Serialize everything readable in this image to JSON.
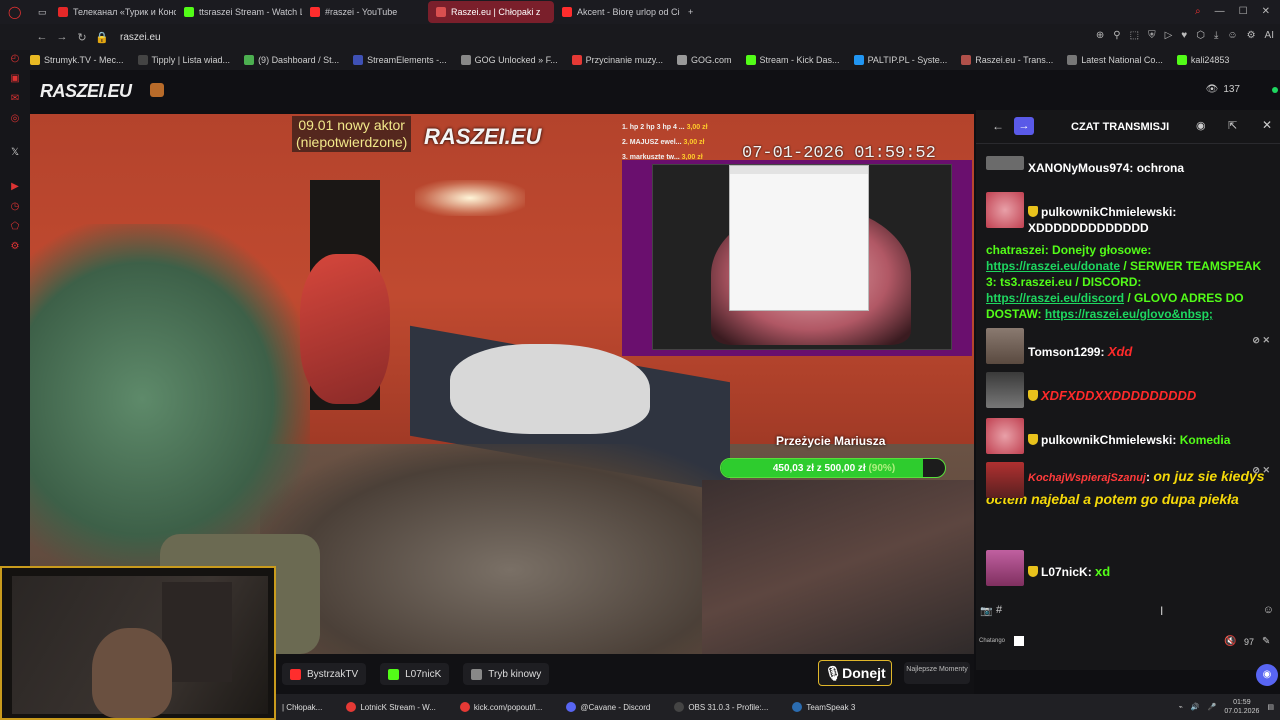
{
  "browser": {
    "tabs": [
      {
        "label": "Телеканал «Турик и Конс",
        "color": "#e52828"
      },
      {
        "label": "ttsraszei Stream - Watch L",
        "color": "#53fc18"
      },
      {
        "label": "#raszei - YouTube",
        "color": "#ff2d2d"
      },
      {
        "label": "Raszei.eu | Chłopaki z",
        "color": "#d94f4f",
        "active": true
      },
      {
        "label": "Akcent - Biorę urlop od Cie",
        "color": "#ff2d2d"
      }
    ],
    "new_tab": "+",
    "url": "raszei.eu",
    "bookmarks": [
      {
        "label": "Strumyk.TV - Mec...",
        "color": "#e8b923"
      },
      {
        "label": "Tipply | Lista wiad...",
        "color": "#222"
      },
      {
        "label": "(9) Dashboard / St...",
        "color": "#4caf50"
      },
      {
        "label": "StreamElements -...",
        "color": "#3f51b5"
      },
      {
        "label": "GOG Unlocked » F...",
        "color": "#888"
      },
      {
        "label": "Przycinanie muzy...",
        "color": "#e53935"
      },
      {
        "label": "GOG.com",
        "color": "#999"
      },
      {
        "label": "Stream - Kick Das...",
        "color": "#53fc18"
      },
      {
        "label": "PALTIP.PL - Syste...",
        "color": "#2196f3"
      },
      {
        "label": "Raszei.eu - Trans...",
        "color": "#b0504a"
      },
      {
        "label": "Latest National Co...",
        "color": "#777"
      },
      {
        "label": "kali24853",
        "color": "#53fc18"
      }
    ]
  },
  "site": {
    "logo": "RASZEI.EU",
    "viewers": "137"
  },
  "video": {
    "overlay_actor_line1": "09.01 nowy aktor",
    "overlay_actor_line2": "(niepotwierdzone)",
    "overlay_logo": "RASZEI.EU",
    "donors": [
      {
        "label": "1. hp 2 hp 3 hp 4 ...",
        "amount": "3,00 zł"
      },
      {
        "label": "2. MAJUSZ ewel...",
        "amount": "3,00 zł"
      },
      {
        "label": "3. markuszte tw...",
        "amount": "3,00 zł"
      }
    ],
    "clock": "07-01-2026 01:59:52",
    "przezycie": "Przeżycie Mariusza",
    "goal_text": "450,03 zł z 500,00 zł",
    "goal_pct_label": "(90%)",
    "goal_fraction": 0.9
  },
  "below": {
    "chips": [
      {
        "label": "BystrzakTV",
        "color": "#ff2d2d"
      },
      {
        "label": "L07nicK",
        "color": "#53fc18"
      },
      {
        "label": "Tryb kinowy",
        "color": "#888"
      }
    ],
    "donate": "Donejt",
    "najlepsze": "Najlepsze Momenty"
  },
  "chat": {
    "title": "CZAT TRANSMISJI",
    "messages": [
      {
        "user": "XANONyMous974",
        "text": "ochrona",
        "ucolor": "#ffffff",
        "tcolor": "#ffffff"
      },
      {
        "user": "pulkownikChmielewski",
        "text": "XDDDDDDDDDDDDD",
        "ucolor": "#ffffff",
        "tcolor": "#ffffff"
      },
      {
        "user": "Tomson1299",
        "text": "Xdd",
        "ucolor": "#ffffff",
        "tcolor": "#ff2a2a"
      },
      {
        "user": "",
        "text": "XDFXDDXXDDDDDDDDD",
        "ucolor": "#ff2a2a",
        "tcolor": "#ff2a2a"
      },
      {
        "user": "pulkownikChmielewski",
        "text": "Komedia",
        "ucolor": "#ffffff",
        "tcolor": "#53fc18"
      },
      {
        "user": "KochajWspierajSzanuj",
        "text": "on juz sie kiedys octem najebal a potem go dupa piekła",
        "ucolor": "#ff3b3b",
        "tcolor": "#f5d90a"
      },
      {
        "user": "L07nicK",
        "text": "xd",
        "ucolor": "#ffffff",
        "tcolor": "#53fc18"
      }
    ],
    "system": {
      "user": "chatraszei",
      "part1": "Donejty głosowe:",
      "link1": "https://raszei.eu/donate",
      "part2": "SERWER TEAMSPEAK 3: ts3.raszei.eu /",
      "part3": "DISCORD:",
      "link2": "https://raszei.eu/discord",
      "part4": "GLOVO ADRES DO DOSTAW:",
      "link3": "https://raszei.eu/glovo&nbsp;"
    },
    "chatango": "Chatango",
    "volume": "97"
  },
  "taskbar": {
    "items": [
      {
        "label": "| Chłopak...",
        "color": "#d94f4f"
      },
      {
        "label": "LotnicK Stream - W...",
        "color": "#e53935"
      },
      {
        "label": "kick.com/popout/l...",
        "color": "#e53935"
      },
      {
        "label": "@Cavane - Discord",
        "color": "#5865f2"
      },
      {
        "label": "OBS 31.0.3 - Profile:...",
        "color": "#333"
      },
      {
        "label": "TeamSpeak 3",
        "color": "#2b6cb0"
      }
    ],
    "time": "01:59",
    "date": "07.01.2026"
  }
}
